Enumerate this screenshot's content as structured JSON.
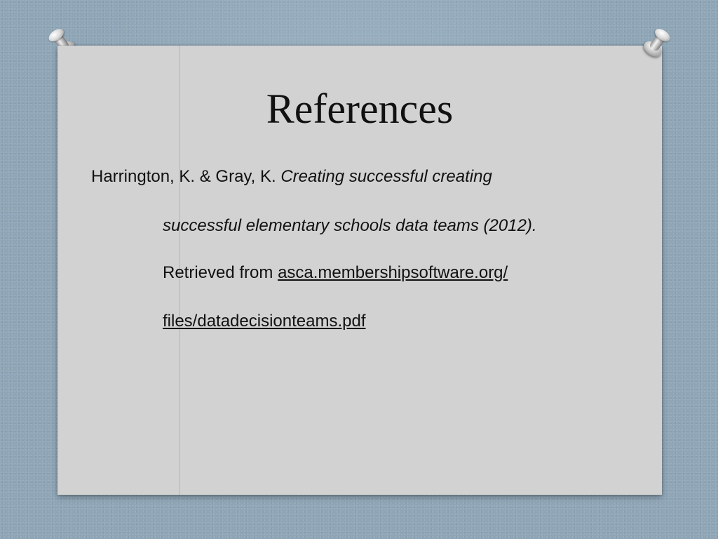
{
  "slide": {
    "title": "References",
    "reference": {
      "line1_plain": "Harrington, K. & Gray, K. ",
      "line1_italic": "Creating successful creating",
      "line2_italic": "successful elementary schools data teams (2012).",
      "line3_plain": "Retrieved from ",
      "line3_link": "asca.membershipsoftware.org/",
      "line4_link": "files/datadecisionteams.pdf"
    }
  },
  "icons": {
    "left_pin": "pushpin-icon",
    "right_pin": "pushpin-icon"
  },
  "colors": {
    "background": "#8fa6b7",
    "card": "#d2d2d2",
    "text": "#111111"
  }
}
